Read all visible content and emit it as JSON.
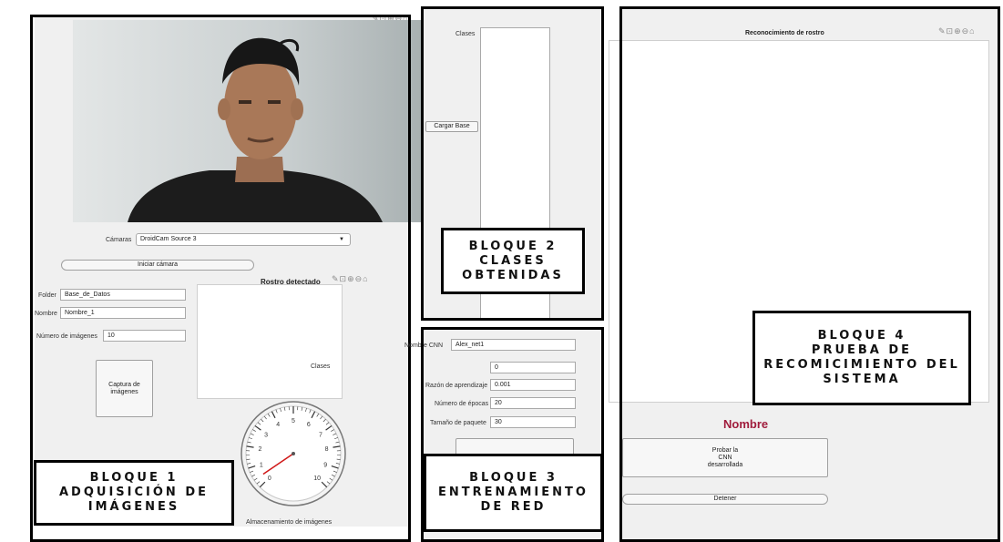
{
  "toolbar_icons": [
    "brush-icon",
    "pan-icon",
    "zoom-in-icon",
    "zoom-out-icon",
    "home-icon"
  ],
  "toolbar_glyphs": "✎⊡⊕⊖⌂",
  "block1": {
    "callout": [
      "BLOQUE 1",
      "ADQUISICIÓN DE",
      "IMÁGENES"
    ],
    "camera_label": "Cámaras",
    "camera_value": "DroidCam Source 3",
    "start_camera_button": "Iniciar cámara",
    "detected_face_title": "Rostro detectado",
    "folder_label": "Folder",
    "folder_value": "Base_de_Datos",
    "name_label": "Nombre",
    "name_value": "Nombre_1",
    "num_images_label": "Número de imágenes",
    "num_images_value": "10",
    "capture_button": [
      "Captura de",
      "imágenes"
    ],
    "classes_text": "Clases",
    "gauge_caption": "Almacenamiento de imágenes",
    "gauge": {
      "min": 0,
      "max": 10,
      "value": 0.4,
      "tick_labels": [
        "0",
        "1",
        "2",
        "3",
        "4",
        "5",
        "6",
        "7",
        "8",
        "9",
        "10"
      ]
    }
  },
  "block2": {
    "callout": [
      "BLOQUE 2",
      "CLASES",
      "OBTENIDAS"
    ],
    "classes_label": "Clases",
    "load_base_button": "Cargar Base"
  },
  "block3": {
    "callout": [
      "BLOQUE 3",
      "ENTRENAMIENTO",
      "DE RED"
    ],
    "cnn_name_label": "Nombre CNN",
    "cnn_name_value": "Alex_net1",
    "unknown_value": "0",
    "learning_rate_label": "Razón de aprendizaje",
    "learning_rate_value": "0.001",
    "epochs_label": "Número de épocas",
    "epochs_value": "20",
    "batch_size_label": "Tamaño de paquete",
    "batch_size_value": "30"
  },
  "block4": {
    "callout": [
      "BLOQUE 4",
      "PRUEBA DE",
      "RECOMICIMIENTO DEL",
      "SISTEMA"
    ],
    "recognition_title": "Reconocimiento de rostro",
    "name_result": "Nombre",
    "name_result_color": "#a01c3c",
    "test_button": [
      "Probar la",
      "CNN",
      "desarrollada"
    ],
    "stop_button": "Detener"
  }
}
